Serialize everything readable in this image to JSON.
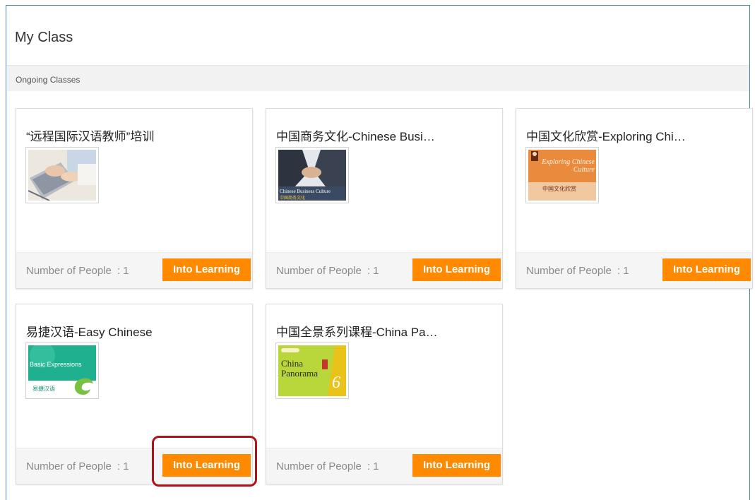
{
  "page": {
    "title": "My Class",
    "section_label": "Ongoing Classes"
  },
  "cards": [
    {
      "title": "“远程国际汉语教师”培训",
      "people_label": "Number of People",
      "people_sep": ":",
      "people_count": "1",
      "button": "Into Learning",
      "thumb_icon": "laptop-typing-photo"
    },
    {
      "title": "中国商务文化-Chinese Busi…",
      "people_label": "Number of People",
      "people_sep": ":",
      "people_count": "1",
      "button": "Into Learning",
      "thumb_icon": "handshake-photo",
      "thumb_text": "Chinese Business Culture",
      "thumb_subtext": "中国商务文化"
    },
    {
      "title": "中国文化欣赏-Exploring Chi…",
      "people_label": "Number of People",
      "people_sep": ":",
      "people_count": "1",
      "button": "Into Learning",
      "thumb_icon": "book-cover-culture",
      "thumb_text": "Exploring Chinese Culture",
      "thumb_subtext": "中国文化欣赏"
    },
    {
      "title": "易捷汉语-Easy Chinese",
      "people_label": "Number of People",
      "people_sep": ":",
      "people_count": "1",
      "button": "Into Learning",
      "thumb_icon": "easy-chinese-cover",
      "thumb_text": "Basic Expressions",
      "thumb_subtext": "易捷汉语"
    },
    {
      "title": "中国全景系列课程-China Pa…",
      "people_label": "Number of People",
      "people_sep": ":",
      "people_count": "1",
      "button": "Into Learning",
      "thumb_icon": "china-panorama-cover",
      "thumb_text": "China",
      "thumb_subtext": "Panorama",
      "thumb_number": "6"
    }
  ],
  "colors": {
    "button": "#ff8a00",
    "highlight": "#b0121b",
    "frame": "#4a7ebb"
  }
}
